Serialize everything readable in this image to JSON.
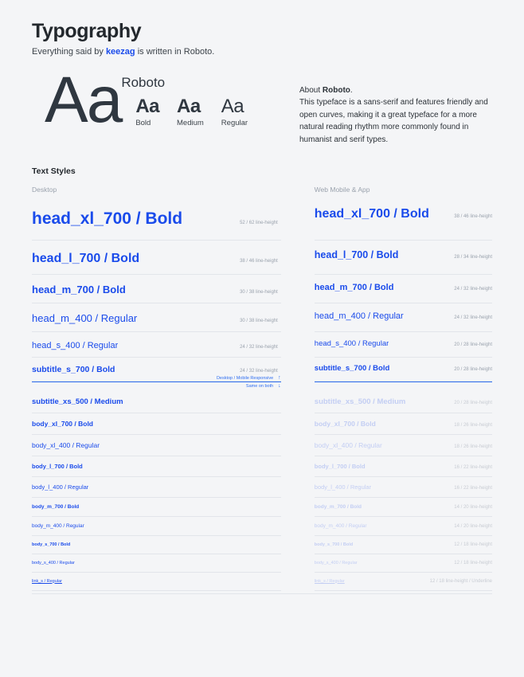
{
  "header": {
    "title": "Typography",
    "subtitle_before": "Everything said by ",
    "brand": "keezag",
    "subtitle_after": " is written in Roboto."
  },
  "specimen": {
    "big_sample": "Aa",
    "font_name": "Roboto",
    "weights": [
      {
        "sample": "Aa",
        "label": "Bold"
      },
      {
        "sample": "Aa",
        "label": "Medium"
      },
      {
        "sample": "Aa",
        "label": "Regular"
      }
    ],
    "about": {
      "lead": "About ",
      "lead_bold": "Roboto",
      "lead_end": ".",
      "body": "This typeface is a sans-serif and features friendly and open curves, making it a great typeface for a more natural reading rhythm more commonly found in humanist and serif types."
    }
  },
  "styles": {
    "section_title": "Text Styles",
    "column_headers": {
      "left": "Desktop",
      "right": "Web Mobile & App"
    },
    "divider_note_above": "Desktop / Mobile Responsive",
    "divider_note_above_arrow": "↑",
    "divider_note_below": "Same on both",
    "divider_note_below_arrow": "↓",
    "rows": [
      {
        "left": {
          "label": "head_xl_700 / Bold",
          "meta": "52 / 62 line-height",
          "size": 21,
          "weight": 700,
          "faded": false
        },
        "right": {
          "label": "head_xl_700 / Bold",
          "meta": "38 / 46 line-height",
          "size": 16,
          "weight": 700,
          "faded": false
        }
      },
      {
        "left": {
          "label": "head_l_700 / Bold",
          "meta": "38 / 46 line-height",
          "size": 16,
          "weight": 700,
          "faded": false
        },
        "right": {
          "label": "head_l_700 / Bold",
          "meta": "28 / 34 line-height",
          "size": 12.5,
          "weight": 700,
          "faded": false
        }
      },
      {
        "left": {
          "label": "head_m_700 / Bold",
          "meta": "30 / 38 line-height",
          "size": 13,
          "weight": 700,
          "faded": false
        },
        "right": {
          "label": "head_m_700 / Bold",
          "meta": "24 / 32 line-height",
          "size": 11,
          "weight": 700,
          "faded": false
        }
      },
      {
        "left": {
          "label": "head_m_400 / Regular",
          "meta": "30 / 38 line-height",
          "size": 13,
          "weight": 400,
          "faded": false
        },
        "right": {
          "label": "head_m_400 / Regular",
          "meta": "24 / 32 line-height",
          "size": 11,
          "weight": 400,
          "faded": false
        }
      },
      {
        "left": {
          "label": "head_s_400 / Regular",
          "meta": "24 / 32 line-height",
          "size": 11,
          "weight": 400,
          "faded": false
        },
        "right": {
          "label": "head_s_400 / Regular",
          "meta": "20 / 28 line-height",
          "size": 9.5,
          "weight": 400,
          "faded": false
        }
      },
      {
        "left": {
          "label": "subtitle_s_700 / Bold",
          "meta": "24 / 32 line-height",
          "size": 10.5,
          "weight": 700,
          "faded": false
        },
        "right": {
          "label": "subtitle_s_700 / Bold",
          "meta": "20 / 28 line-height",
          "size": 9.5,
          "weight": 700,
          "faded": false
        }
      },
      {
        "left": {
          "label": "subtitle_xs_500 / Medium",
          "meta": "",
          "size": 9.5,
          "weight": 600,
          "faded": false
        },
        "right": {
          "label": "subtitle_xs_500 / Medium",
          "meta": "20 / 28 line-height",
          "size": 9.5,
          "weight": 600,
          "faded": true
        }
      },
      {
        "left": {
          "label": "body_xl_700 / Bold",
          "meta": "",
          "size": 8.5,
          "weight": 700,
          "faded": false
        },
        "right": {
          "label": "body_xl_700 / Bold",
          "meta": "18 / 26 line-height",
          "size": 8.5,
          "weight": 700,
          "faded": true
        }
      },
      {
        "left": {
          "label": "body_xl_400 / Regular",
          "meta": "",
          "size": 8.5,
          "weight": 400,
          "faded": false
        },
        "right": {
          "label": "body_xl_400 / Regular",
          "meta": "18 / 26 line-height",
          "size": 8.5,
          "weight": 400,
          "faded": true
        }
      },
      {
        "left": {
          "label": "body_l_700 / Bold",
          "meta": "",
          "size": 7.5,
          "weight": 700,
          "faded": false
        },
        "right": {
          "label": "body_l_700 / Bold",
          "meta": "16 / 22 line-height",
          "size": 7.5,
          "weight": 700,
          "faded": true
        }
      },
      {
        "left": {
          "label": "body_l_400 / Regular",
          "meta": "",
          "size": 7.5,
          "weight": 400,
          "faded": false
        },
        "right": {
          "label": "body_l_400 / Regular",
          "meta": "16 / 22 line-height",
          "size": 7.5,
          "weight": 400,
          "faded": true
        }
      },
      {
        "left": {
          "label": "body_m_700 / Bold",
          "meta": "",
          "size": 6.5,
          "weight": 700,
          "faded": false
        },
        "right": {
          "label": "body_m_700 / Bold",
          "meta": "14 / 20 line-height",
          "size": 6.5,
          "weight": 700,
          "faded": true
        }
      },
      {
        "left": {
          "label": "body_m_400 / Regular",
          "meta": "",
          "size": 6.5,
          "weight": 400,
          "faded": false
        },
        "right": {
          "label": "body_m_400 / Regular",
          "meta": "14 / 20 line-height",
          "size": 6.5,
          "weight": 400,
          "faded": true
        }
      },
      {
        "left": {
          "label": "body_s_700 / Bold",
          "meta": "",
          "size": 5.5,
          "weight": 700,
          "faded": false
        },
        "right": {
          "label": "body_s_700 / Bold",
          "meta": "12 / 18 line-height",
          "size": 5.5,
          "weight": 700,
          "faded": true
        }
      },
      {
        "left": {
          "label": "body_s_400 / Regular",
          "meta": "",
          "size": 5.5,
          "weight": 400,
          "faded": false
        },
        "right": {
          "label": "body_s_400 / Regular",
          "meta": "12 / 18 line-height",
          "size": 5.5,
          "weight": 400,
          "faded": true
        }
      },
      {
        "left": {
          "label": "link_s / Regular",
          "meta": "",
          "size": 5.5,
          "weight": 400,
          "faded": false,
          "underline": true
        },
        "right": {
          "label": "link_s / Regular",
          "meta": "12 / 18 line-height / Underline",
          "size": 5.5,
          "weight": 400,
          "faded": true,
          "underline": true
        }
      }
    ]
  },
  "colors": {
    "background": "#f4f5f7",
    "accent_blue": "#1a4beb",
    "faded_blue": "#c3cef3",
    "divider_blue": "#2f6ef0",
    "text_dark": "#23282d",
    "muted": "#9aa2ad",
    "rule": "#e2e5ea"
  }
}
